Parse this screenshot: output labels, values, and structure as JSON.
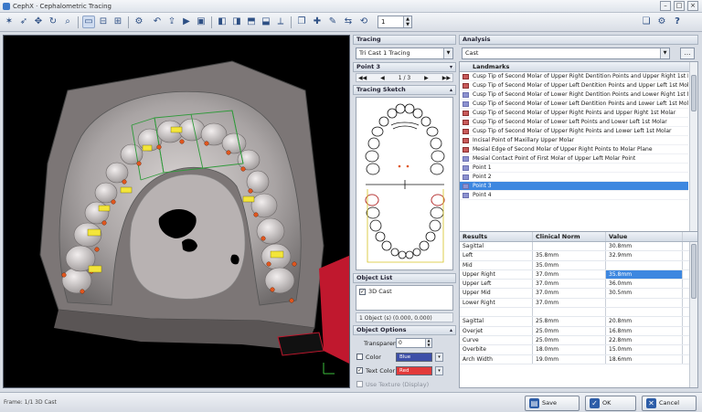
{
  "window": {
    "title": "CephX · Cephalometric Tracing",
    "help_label": "?"
  },
  "toolbar": {
    "frame_value": "1"
  },
  "viewport": {},
  "tracing": {
    "title": "Tracing",
    "selected": "Tri Cast 1 Tracing"
  },
  "point": {
    "title": "Point 3",
    "index": "1 / 3"
  },
  "sketch": {
    "title": "Tracing Sketch"
  },
  "object_list": {
    "title": "Object List",
    "item": "3D Cast",
    "status": "1 Object (s) (0.000, 0.000)"
  },
  "object_options": {
    "title": "Object Options",
    "transparency_label": "Transparency",
    "transparency_value": "0",
    "color_label": "Color",
    "color_value": "Blue",
    "text_color_label": "Text Color",
    "text_color_value": "Red",
    "texture_label": "Use Texture (Display)"
  },
  "analysis": {
    "title": "Analysis",
    "selected": "Cast"
  },
  "landmarks": {
    "title": "Landmarks",
    "items": [
      {
        "label": "Cusp Tip of Second Molar of Upper Right Dentition Points and Upper Right 1st Molar",
        "done": true
      },
      {
        "label": "Cusp Tip of Second Molar of Upper Left Dentition Points and Upper Left 1st Molar",
        "done": true
      },
      {
        "label": "Cusp Tip of Second Molar of Lower Right Dentition Points and Lower Right 1st Molar",
        "done": false
      },
      {
        "label": "Cusp Tip of Second Molar of Lower Left Dentition Points and Lower Left 1st Molar",
        "done": false
      },
      {
        "label": "Cusp Tip of Second Molar of Upper Right Points and Upper Right 1st Molar",
        "done": true
      },
      {
        "label": "Cusp Tip of Second Molar of Lower Left Points and Lower Left 1st Molar",
        "done": true
      },
      {
        "label": "Cusp Tip of Second Molar of Upper Right Points and Lower Left 1st Molar",
        "done": true
      },
      {
        "label": "Incisal Point of Maxillary Upper Molar",
        "done": true
      },
      {
        "label": "Mesial Edge of Second Molar of Upper Right Points to Molar Plane",
        "done": true
      },
      {
        "label": "Mesial Contact Point of First Molar of Upper Left Molar Point",
        "done": false
      },
      {
        "label": "Point 1",
        "done": false
      },
      {
        "label": "Point 2",
        "done": false
      },
      {
        "label": "Point 3",
        "done": false,
        "selected": true
      },
      {
        "label": "Point 4",
        "done": false
      }
    ]
  },
  "results": {
    "headers": [
      "Results",
      "Clinical Norm",
      "Value"
    ],
    "rows": [
      [
        "Sagittal",
        "",
        "30.8mm"
      ],
      [
        "Left",
        "35.8mm",
        "32.9mm"
      ],
      [
        "Mid",
        "35.0mm",
        ""
      ],
      [
        "Upper Right",
        "37.0mm",
        "35.8mm"
      ],
      [
        "Upper Left",
        "37.0mm",
        "36.0mm"
      ],
      [
        "Upper Mid",
        "37.0mm",
        "30.5mm"
      ],
      [
        "Lower Right",
        "37.0mm",
        ""
      ],
      [
        "",
        "",
        ""
      ],
      [
        "Sagittal",
        "25.8mm",
        "20.8mm"
      ],
      [
        "Overjet",
        "25.0mm",
        "16.8mm"
      ],
      [
        "Curve",
        "25.0mm",
        "22.8mm"
      ],
      [
        "Overbite",
        "18.0mm",
        "15.0mm"
      ],
      [
        "Arch Width",
        "19.0mm",
        "18.6mm"
      ]
    ],
    "highlight": {
      "row": 3,
      "col": 2
    }
  },
  "status": {
    "text": "Frame: 1/1   3D Cast"
  },
  "buttons": {
    "save": "Save",
    "ok": "OK",
    "cancel": "Cancel"
  }
}
